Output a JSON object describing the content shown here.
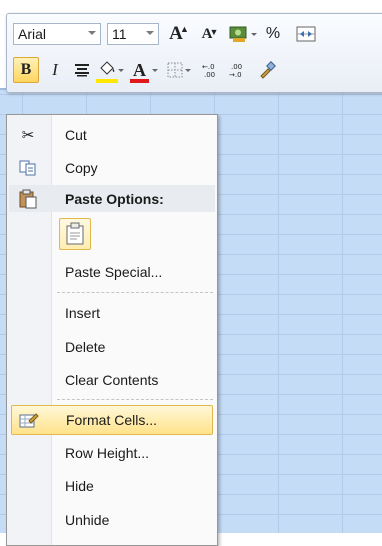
{
  "toolbar": {
    "font_name": "Arial",
    "font_size": "11",
    "percent": "%",
    "italic": "I",
    "bold": "B",
    "font_color_letter": "A",
    "fill_color": "#ffe700",
    "font_color": "#e11818"
  },
  "menu": {
    "items": [
      {
        "label": "Cut",
        "icon": "scissors-icon"
      },
      {
        "label": "Copy",
        "icon": "copy-icon"
      },
      {
        "label": "Paste Options:",
        "icon": "paste-icon"
      },
      {
        "label": "Paste Special...",
        "icon": ""
      },
      {
        "label": "Insert",
        "icon": ""
      },
      {
        "label": "Delete",
        "icon": ""
      },
      {
        "label": "Clear Contents",
        "icon": ""
      },
      {
        "label": "Format Cells...",
        "icon": "format-cells-icon"
      },
      {
        "label": "Row Height...",
        "icon": ""
      },
      {
        "label": "Hide",
        "icon": ""
      },
      {
        "label": "Unhide",
        "icon": ""
      }
    ]
  }
}
